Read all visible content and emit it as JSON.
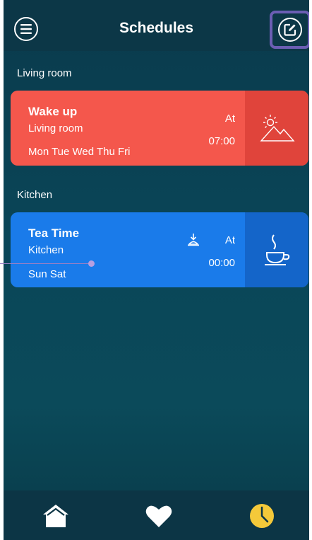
{
  "header": {
    "title": "Schedules",
    "menu_icon": "menu-icon",
    "edit_icon": "edit-icon",
    "highlight_color": "#6b5eb3"
  },
  "sections": [
    {
      "label": "Living room",
      "schedules": [
        {
          "title": "Wake up",
          "room": "Living room",
          "days": "Mon Tue Wed Thu Fri",
          "at_label": "At",
          "time": "07:00",
          "icon": "sunrise-mountain-icon",
          "color": "#f4574c",
          "side_color": "#e0443b"
        }
      ]
    },
    {
      "label": "Kitchen",
      "schedules": [
        {
          "title": "Tea Time",
          "room": "Kitchen",
          "days": "Sun Sat",
          "at_label": "At",
          "time": "00:00",
          "icon": "tea-cup-icon",
          "indicator_icon": "download-alert-icon",
          "color": "#1a7bea",
          "side_color": "#1465c9"
        }
      ]
    }
  ],
  "bottom_nav": {
    "items": [
      {
        "name": "home",
        "icon": "home-icon",
        "active": false
      },
      {
        "name": "favorites",
        "icon": "heart-icon",
        "active": false
      },
      {
        "name": "schedules",
        "icon": "clock-icon",
        "active": true
      }
    ],
    "active_color": "#f4c93a"
  }
}
